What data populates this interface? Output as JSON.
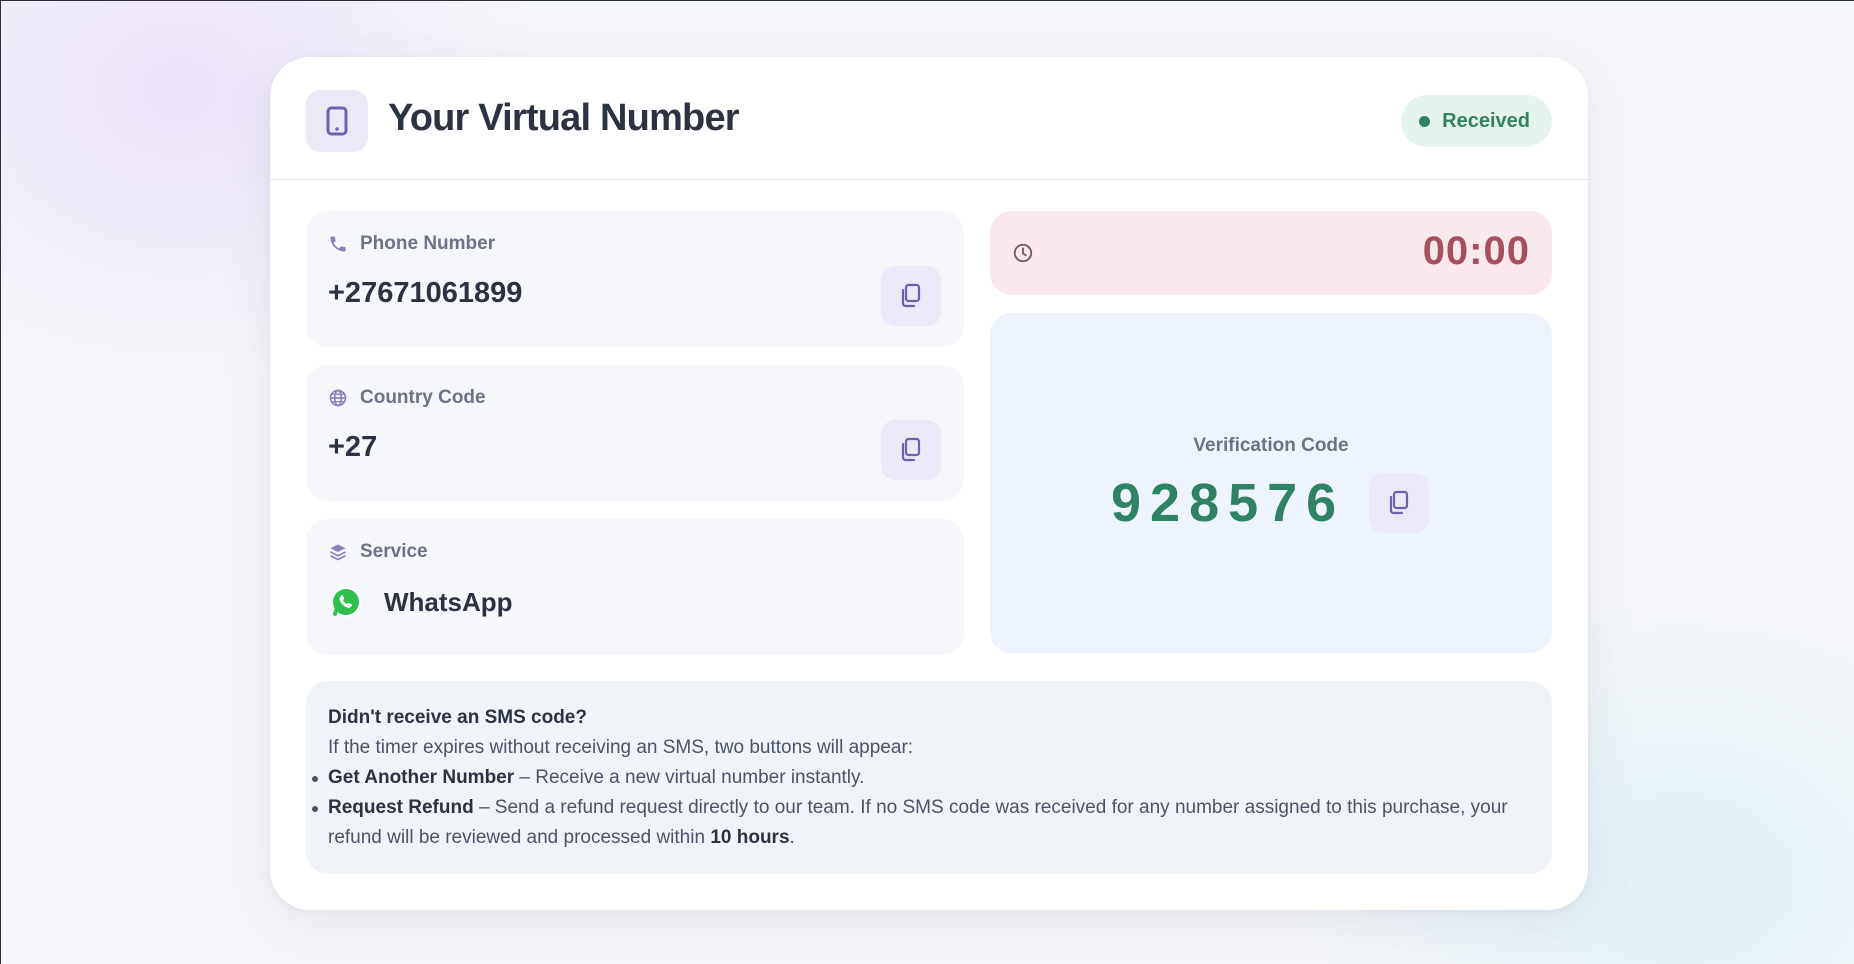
{
  "header": {
    "title": "Your Virtual Number",
    "icon": "smartphone-icon",
    "status": "Received",
    "status_color": "#2f8262"
  },
  "phone": {
    "label": "Phone Number",
    "value": "+27671061899",
    "icon": "phone-icon"
  },
  "country": {
    "label": "Country Code",
    "value": "+27",
    "icon": "globe-icon"
  },
  "service": {
    "label": "Service",
    "value": "WhatsApp",
    "icon": "layers-icon"
  },
  "timer": {
    "value": "00:00",
    "icon": "clock-icon",
    "color": "#a84f5f"
  },
  "verification": {
    "label": "Verification Code",
    "code": "928576",
    "color": "#2f8262"
  },
  "help": {
    "title": "Didn't receive an SMS code?",
    "intro": "If the timer expires without receiving an SMS, two buttons will appear:",
    "item1_bold": "Get Another Number",
    "item1_text": " – Receive a new virtual number instantly.",
    "item2_bold": "Request Refund",
    "item2_text": " – Send a refund request directly to our team. If no SMS code was received for any number assigned to this purchase, your refund will be reviewed and processed within ",
    "item2_hours": "10 hours",
    "item2_end": "."
  },
  "colors": {
    "accent": "#6f5fb0",
    "title": "#2b3242"
  }
}
